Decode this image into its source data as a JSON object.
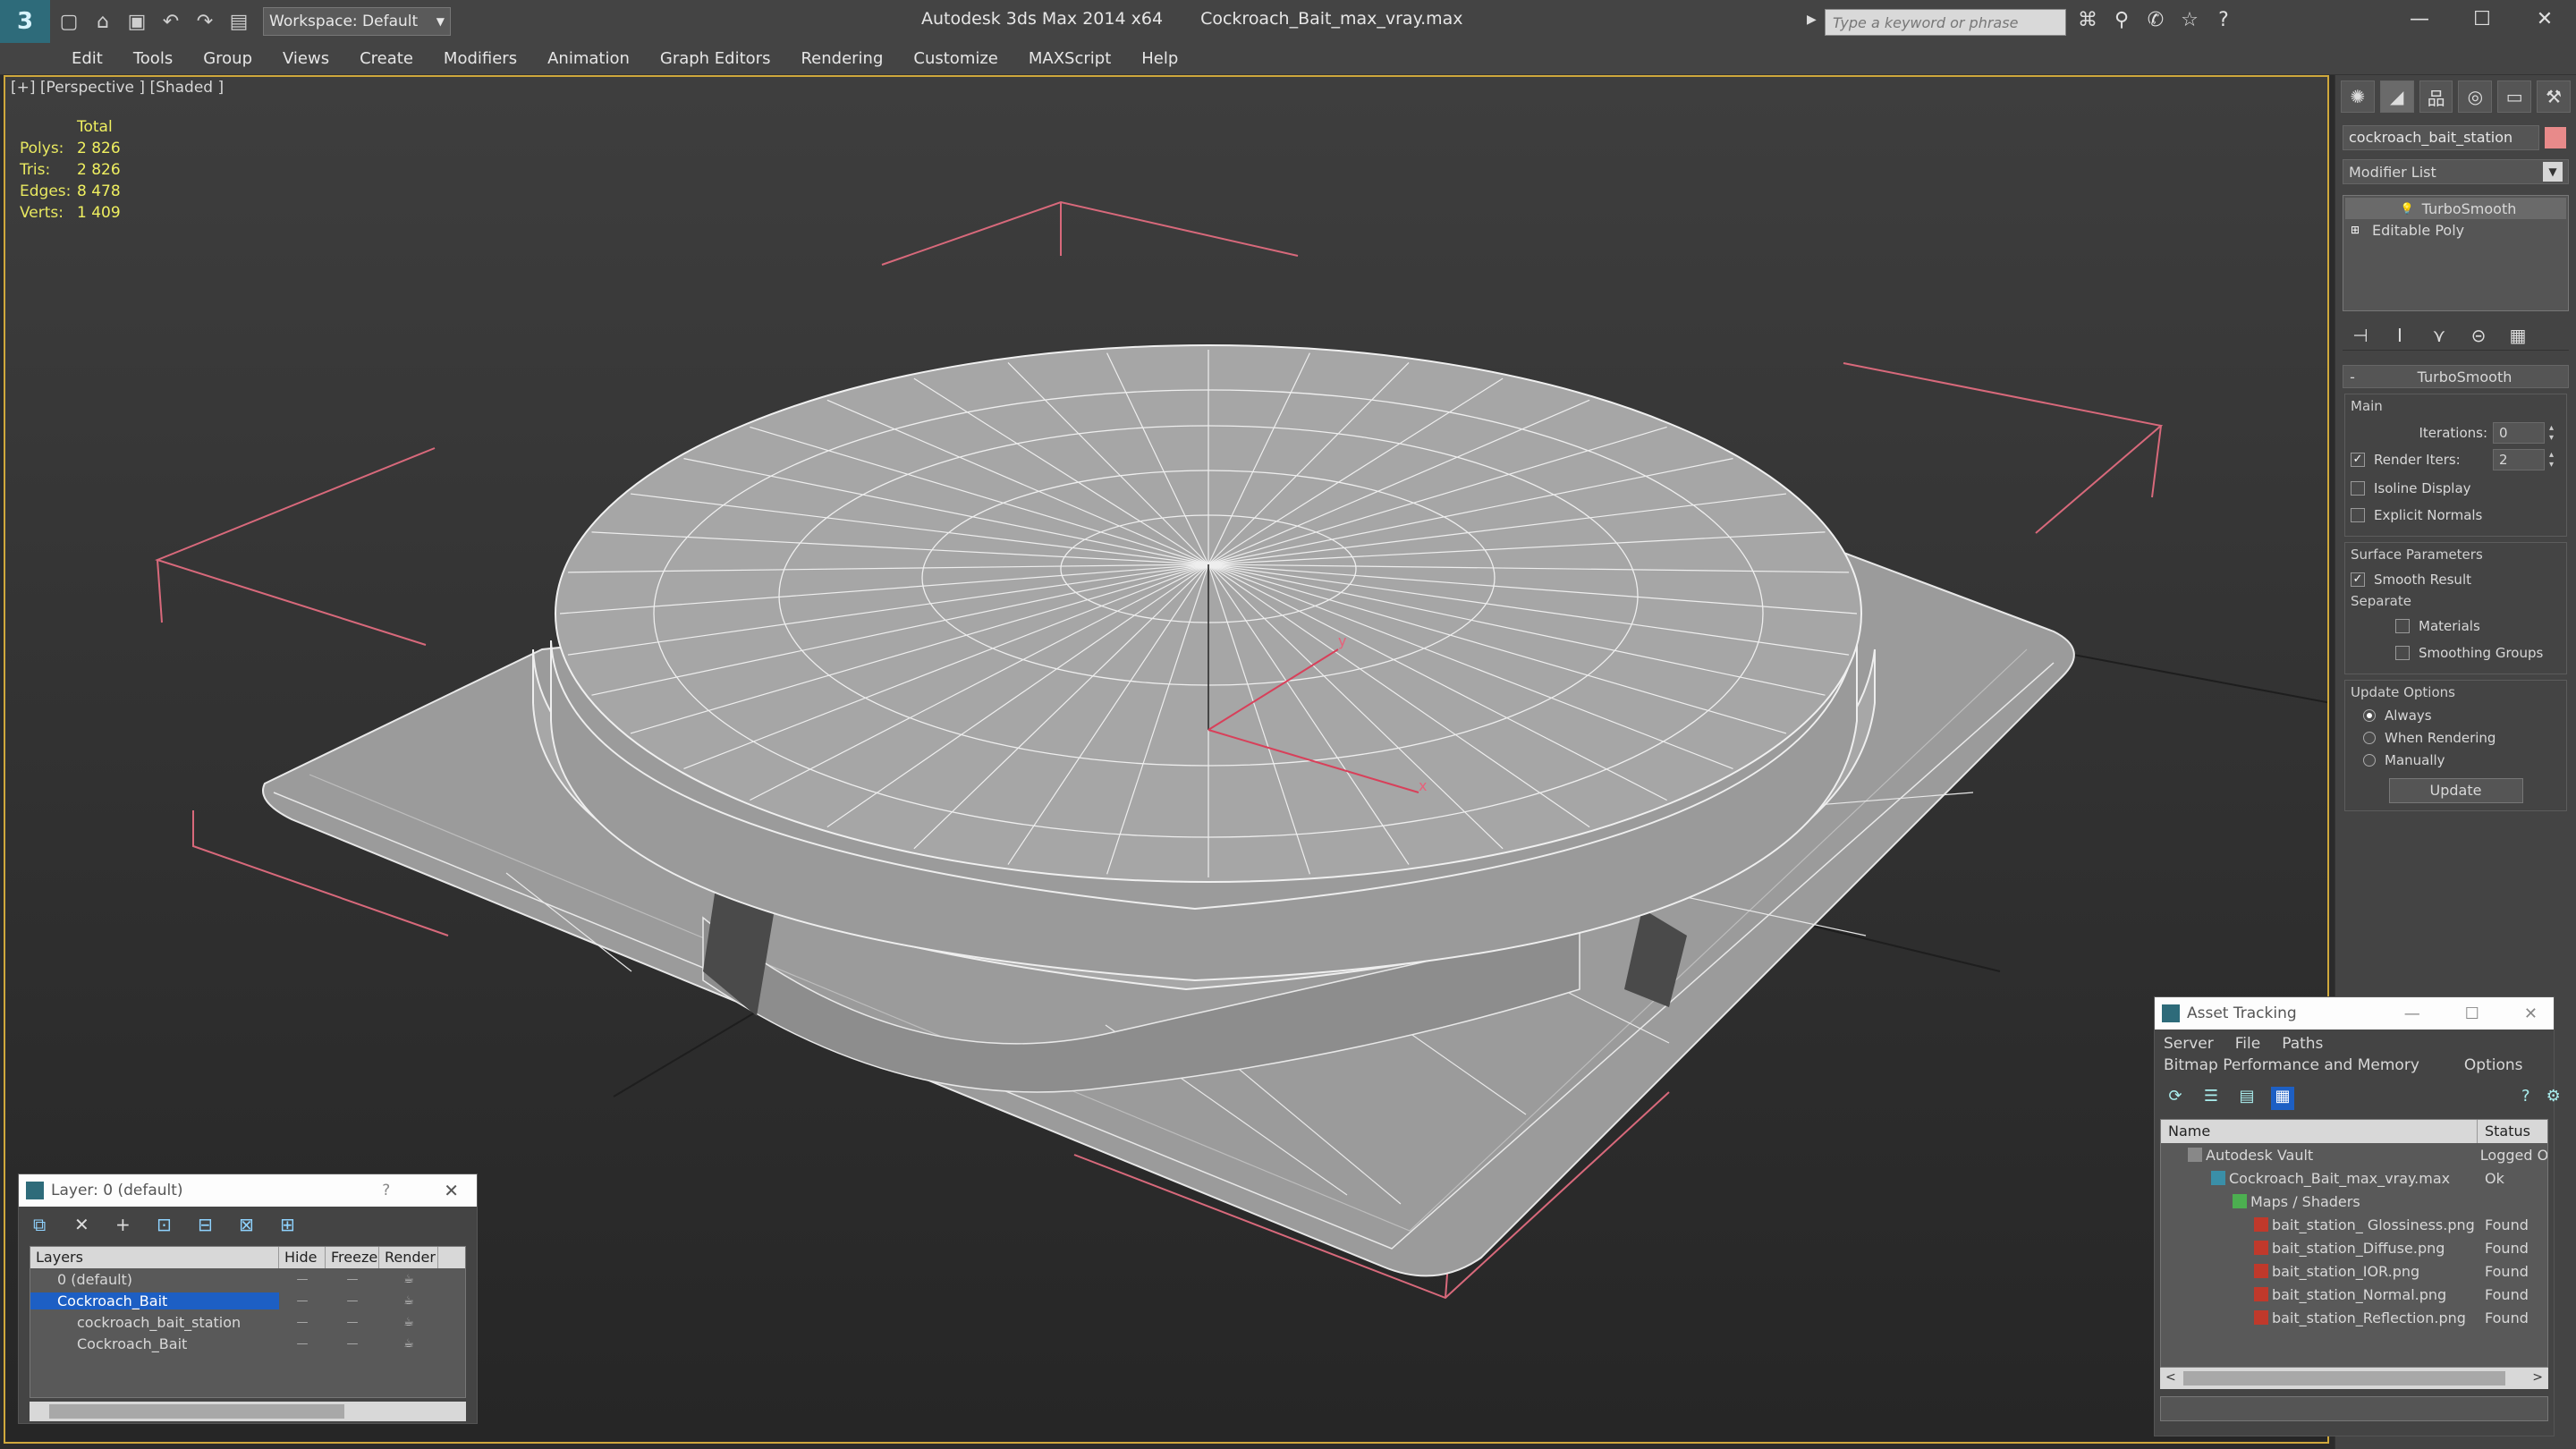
{
  "titlebar": {
    "workspace": "Workspace: Default",
    "app_title": "Autodesk 3ds Max  2014 x64",
    "file_title": "Cockroach_Bait_max_vray.max",
    "search_placeholder": "Type a keyword or phrase"
  },
  "menu": [
    "Edit",
    "Tools",
    "Group",
    "Views",
    "Create",
    "Modifiers",
    "Animation",
    "Graph Editors",
    "Rendering",
    "Customize",
    "MAXScript",
    "Help"
  ],
  "viewport": {
    "label": "[+] [Perspective ] [Shaded ]",
    "stats": {
      "header": "Total",
      "rows": [
        {
          "k": "Polys:",
          "v": "2 826"
        },
        {
          "k": "Tris:",
          "v": "2 826"
        },
        {
          "k": "Edges:",
          "v": "8 478"
        },
        {
          "k": "Verts:",
          "v": "1 409"
        }
      ]
    },
    "axis_x": "x",
    "axis_y": "y"
  },
  "command_panel": {
    "object_name": "cockroach_bait_station",
    "object_color": "#e88a8a",
    "modifier_list": "Modifier List",
    "stack": [
      "TurboSmooth",
      "Editable Poly"
    ],
    "rollout_title": "TurboSmooth",
    "main": {
      "title": "Main",
      "iterations_label": "Iterations:",
      "iterations_value": "0",
      "render_iters_label": "Render Iters:",
      "render_iters_value": "2",
      "isoline": "Isoline Display",
      "explicit": "Explicit Normals"
    },
    "surface": {
      "title": "Surface Parameters",
      "smooth_result": "Smooth Result",
      "separate": "Separate",
      "materials": "Materials",
      "smoothing_groups": "Smoothing Groups"
    },
    "update": {
      "title": "Update Options",
      "always": "Always",
      "when_rendering": "When Rendering",
      "manually": "Manually",
      "button": "Update"
    }
  },
  "layer_panel": {
    "title": "Layer: 0 (default)",
    "question": "?",
    "columns": [
      "Layers",
      "Hide",
      "Freeze",
      "Render"
    ],
    "rows": [
      {
        "name": "0 (default)",
        "child": false,
        "selected": false
      },
      {
        "name": "Cockroach_Bait",
        "child": false,
        "selected": true
      },
      {
        "name": "cockroach_bait_station",
        "child": true,
        "selected": false
      },
      {
        "name": "Cockroach_Bait",
        "child": true,
        "selected": false
      }
    ]
  },
  "asset_tracking": {
    "title": "Asset Tracking",
    "menu1": [
      "Server",
      "File",
      "Paths"
    ],
    "menu2": [
      "Bitmap Performance and Memory",
      "Options"
    ],
    "columns": [
      "Name",
      "Status"
    ],
    "rows": [
      {
        "name": "Autodesk Vault",
        "status": "Logged O",
        "indent": 1
      },
      {
        "name": "Cockroach_Bait_max_vray.max",
        "status": "Ok",
        "indent": 2
      },
      {
        "name": "Maps / Shaders",
        "status": "",
        "indent": 3
      },
      {
        "name": "bait_station_ Glossiness.png",
        "status": "Found",
        "indent": 4
      },
      {
        "name": "bait_station_Diffuse.png",
        "status": "Found",
        "indent": 4
      },
      {
        "name": "bait_station_IOR.png",
        "status": "Found",
        "indent": 4
      },
      {
        "name": "bait_station_Normal.png",
        "status": "Found",
        "indent": 4
      },
      {
        "name": "bait_station_Reflection.png",
        "status": "Found",
        "indent": 4
      }
    ]
  }
}
